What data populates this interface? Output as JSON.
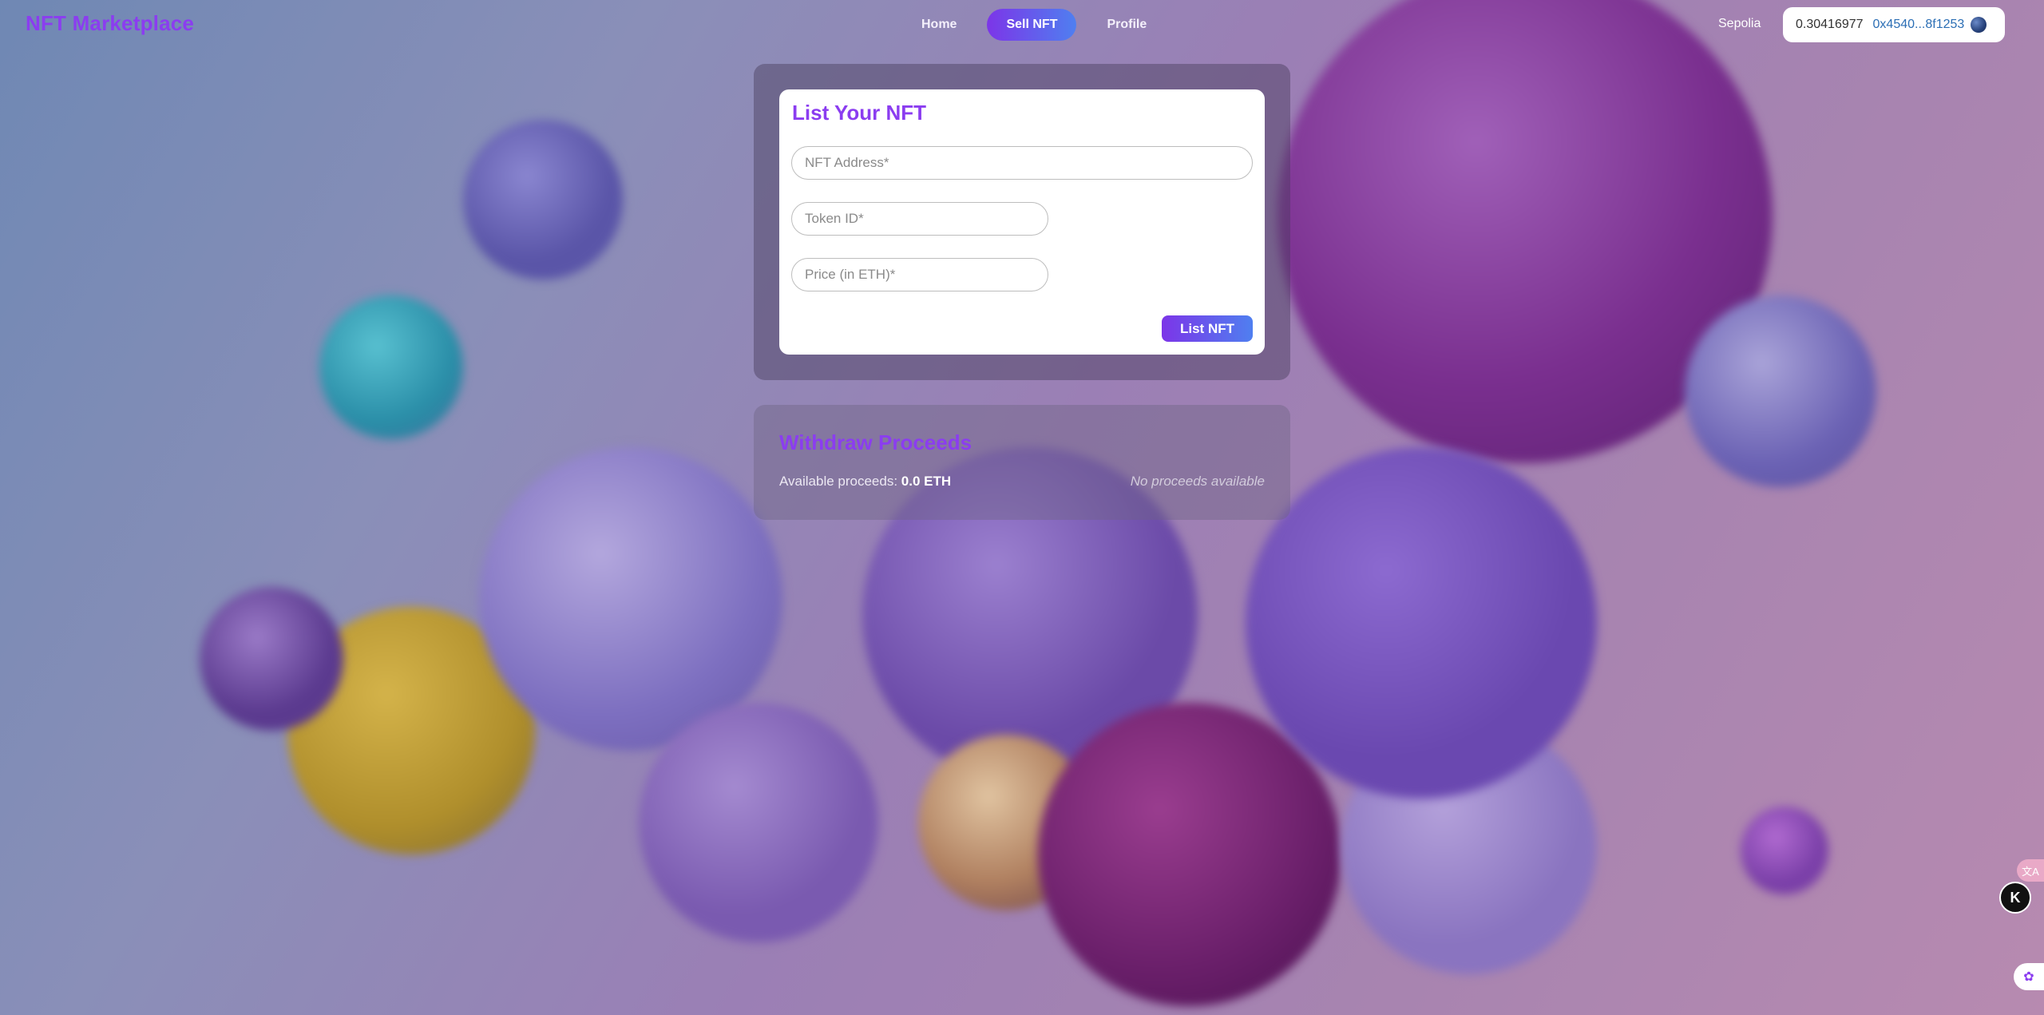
{
  "nav": {
    "brand": "NFT Marketplace",
    "links": [
      {
        "label": "Home",
        "active": false
      },
      {
        "label": "Sell NFT",
        "active": true
      },
      {
        "label": "Profile",
        "active": false
      }
    ],
    "network": "Sepolia",
    "wallet": {
      "balance": "0.30416977",
      "address": "0x4540...8f1253",
      "avatar_icon": "wallet-avatar-icon"
    }
  },
  "list_form": {
    "title": "List Your NFT",
    "nft_address": {
      "value": "",
      "placeholder": "NFT Address*"
    },
    "token_id": {
      "value": "",
      "placeholder": "Token ID*"
    },
    "price": {
      "value": "",
      "placeholder": "Price (in ETH)*"
    },
    "submit_label": "List NFT"
  },
  "withdraw": {
    "title": "Withdraw Proceeds",
    "available_label": "Available proceeds:",
    "available_value": "0.0 ETH",
    "status_text": "No proceeds available"
  },
  "side_widgets": {
    "pink_icon": "translate-icon",
    "pink_glyph": "文A",
    "k_icon": "k-icon",
    "k_glyph": "K",
    "brain_icon": "brain-icon",
    "brain_glyph": "✿"
  },
  "colors": {
    "accent": "#8b3df0",
    "gradient_start": "#7c35e8",
    "gradient_end": "#4f7ff0",
    "wallet_address": "#2c6fb5"
  }
}
